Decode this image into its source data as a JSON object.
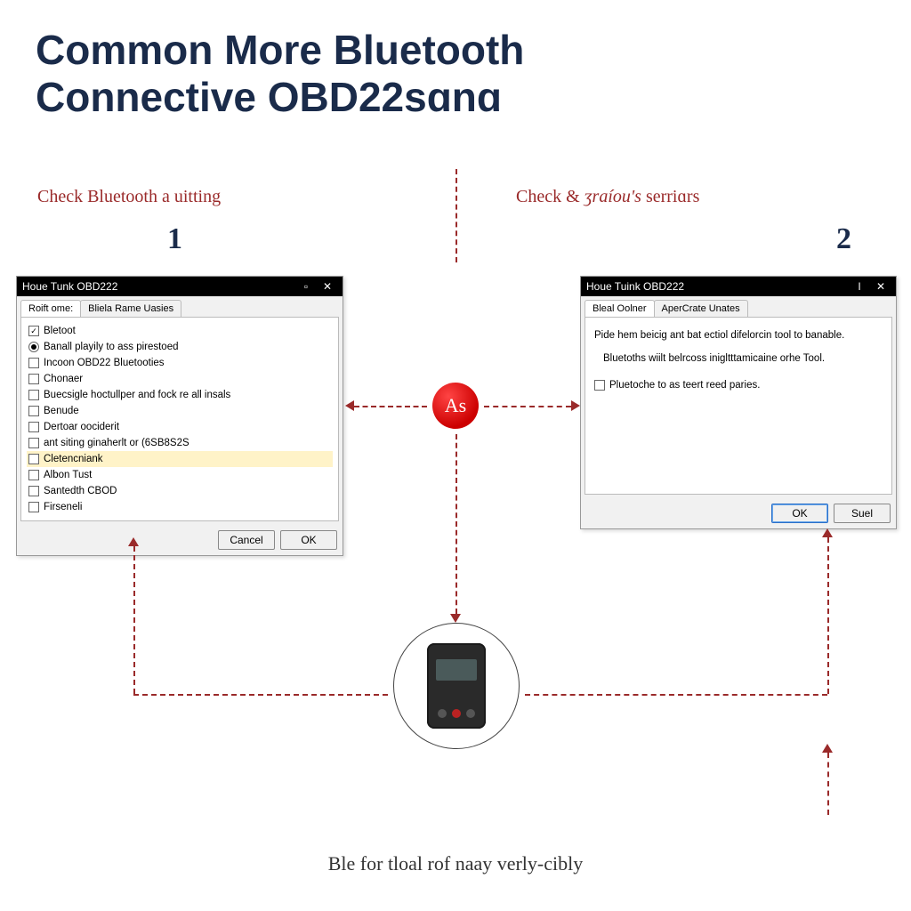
{
  "title_line1": "Common More Bluetooth",
  "title_line2": "Connective OBD22sɑnɑ",
  "step1": {
    "label_reg": "Check Bluetooth a uitting",
    "num": "1",
    "window": {
      "title": "Houe Tunk OBD222",
      "min_sym": "▫",
      "close_sym": "✕",
      "tabs": [
        "Roift ome:",
        "Bliela Rame Uasies"
      ],
      "options": [
        {
          "kind": "check",
          "checked": true,
          "label": "Bletoot"
        },
        {
          "kind": "radio",
          "checked": true,
          "label": "Banall playily to ass pirestoed"
        },
        {
          "kind": "check",
          "checked": false,
          "label": "Incoon OBD22 Bluetooties"
        },
        {
          "kind": "check",
          "checked": false,
          "label": "Chonaer"
        },
        {
          "kind": "check",
          "checked": false,
          "label": "Buecsigle hoctullper and fock re all insals"
        },
        {
          "kind": "check",
          "checked": false,
          "label": "Benude"
        },
        {
          "kind": "check",
          "checked": false,
          "label": "Dertoar oociderit"
        },
        {
          "kind": "check",
          "checked": false,
          "label": "ant siting ginaherlt or (6SB8S2S"
        },
        {
          "kind": "check",
          "checked": false,
          "label": "Cletencniank",
          "highlight": true
        },
        {
          "kind": "check",
          "checked": false,
          "label": "Albon Tust"
        },
        {
          "kind": "check",
          "checked": false,
          "label": "Santedth CBOD"
        },
        {
          "kind": "check",
          "checked": false,
          "label": "Firseneli"
        }
      ],
      "buttons": {
        "cancel": "Cancel",
        "ok": "OK"
      }
    }
  },
  "step2": {
    "label_reg": "Check & ",
    "label_it": "ʒraíou's",
    "label_reg2": " serriɑrs",
    "num": "2",
    "window": {
      "title": "Houe Tuink OBD222",
      "min_sym": "I",
      "close_sym": "✕",
      "tabs": [
        "Bleal Oolner",
        "AperCrate Unates"
      ],
      "body_p1": "Pide hem beicig ant bat ectiol difelorcin tool to banable.",
      "body_p2": "Bluetoths wiilt belrcoss inigltttamicaine orhe Tool.",
      "body_chk": "Pluetoche to as teert reed paries.",
      "buttons": {
        "ok": "OK",
        "save": "Suel"
      }
    }
  },
  "center_icon_glyph": "As",
  "bottom_caption": "Ble for tloal rof naay verly-cibly",
  "colors": {
    "accent": "#9a2a2a",
    "title": "#1a2b4a",
    "red": "#c00"
  }
}
